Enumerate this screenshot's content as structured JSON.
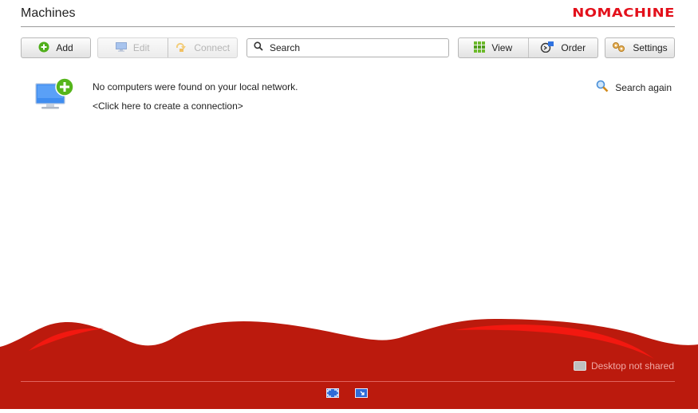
{
  "header": {
    "title": "Machines",
    "logo_text": "NOMACHINE"
  },
  "toolbar": {
    "add_label": "Add",
    "edit_label": "Edit",
    "connect_label": "Connect",
    "search_placeholder": "Search",
    "view_label": "View",
    "order_label": "Order",
    "settings_label": "Settings"
  },
  "main": {
    "empty_message": "No computers were found on your local network.",
    "create_link": "<Click here to create a connection>",
    "search_again_label": "Search again"
  },
  "footer": {
    "desktop_status": "Desktop not shared"
  },
  "colors": {
    "brand_red": "#e3101b",
    "footer_red": "#bb1a0d",
    "accent_green": "#55b51b"
  }
}
